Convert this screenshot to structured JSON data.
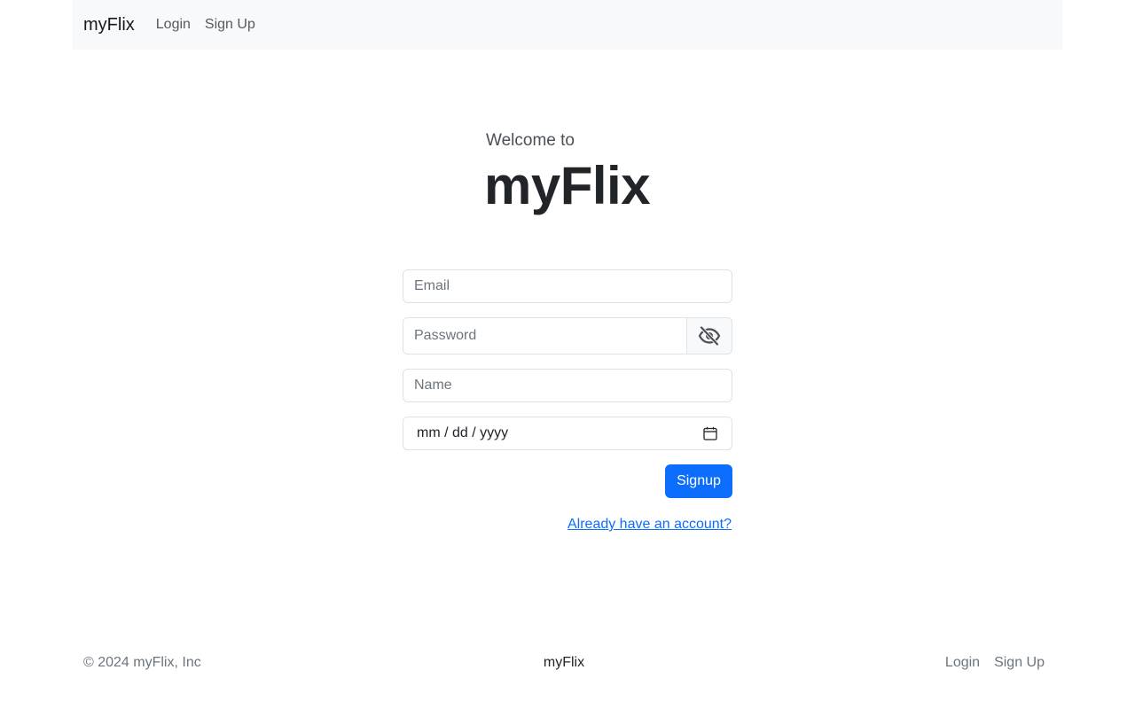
{
  "navbar": {
    "brand": "myFlix",
    "links": [
      "Login",
      "Sign Up"
    ]
  },
  "hero": {
    "subtitle": "Welcome to",
    "title": "myFlix"
  },
  "form": {
    "email_placeholder": "Email",
    "password_placeholder": "Password",
    "name_placeholder": "Name",
    "date_placeholder": "mm / dd / yyyy",
    "submit_label": "Signup",
    "login_link": "Already have an account?"
  },
  "footer": {
    "copyright": "© 2024 myFlix, Inc",
    "brand": "myFlix",
    "links": [
      "Login",
      "Sign Up"
    ]
  },
  "colors": {
    "primary": "#0d6efd",
    "navbar_bg": "#f8f9fa",
    "border": "#dee2e6"
  },
  "icons": {
    "password_toggle": "eye-slash-icon",
    "date_picker": "calendar-icon"
  }
}
